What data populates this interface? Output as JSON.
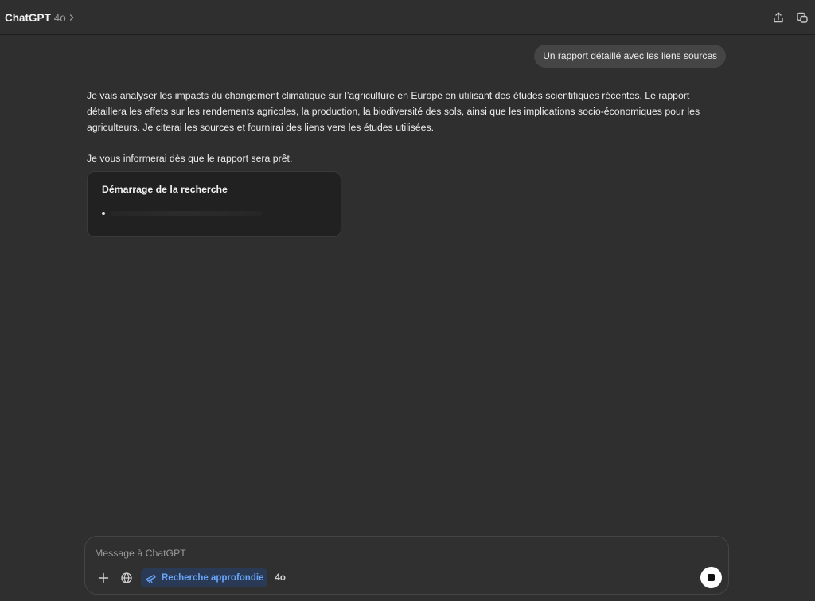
{
  "header": {
    "app_name": "ChatGPT",
    "model_version": "4o",
    "icons": [
      "chevron-right-icon",
      "share-icon",
      "new-window-icon"
    ]
  },
  "conversation": {
    "user_message": "Un rapport détaillé avec les liens sources",
    "assistant_paragraph_1": "Je vais analyser les impacts du changement climatique sur l’agriculture en Europe en utilisant des études scientifiques récentes. Le rapport détaillera les effets sur les rendements agricoles, la production, la biodiversité des sols, ainsi que les implications socio-économiques pour les agriculteurs. Je citerai les sources et fournirai des liens vers les études utilisées.",
    "assistant_paragraph_2": "Je vous informerai dès que le rapport sera prêt.",
    "research_card": {
      "title": "Démarrage de la recherche"
    }
  },
  "composer": {
    "placeholder": "Message à ChatGPT",
    "value": "",
    "deep_research_label": "Recherche approfondie",
    "model_tag": "4o",
    "icons": [
      "plus-icon",
      "globe-icon",
      "telescope-icon",
      "stop-icon"
    ],
    "accent_color": "#6aa6f8"
  },
  "colors": {
    "background": "#2f2f2f",
    "user_bubble": "#454545",
    "card_background": "#212121",
    "deep_research_bg": "#2a3a55"
  }
}
